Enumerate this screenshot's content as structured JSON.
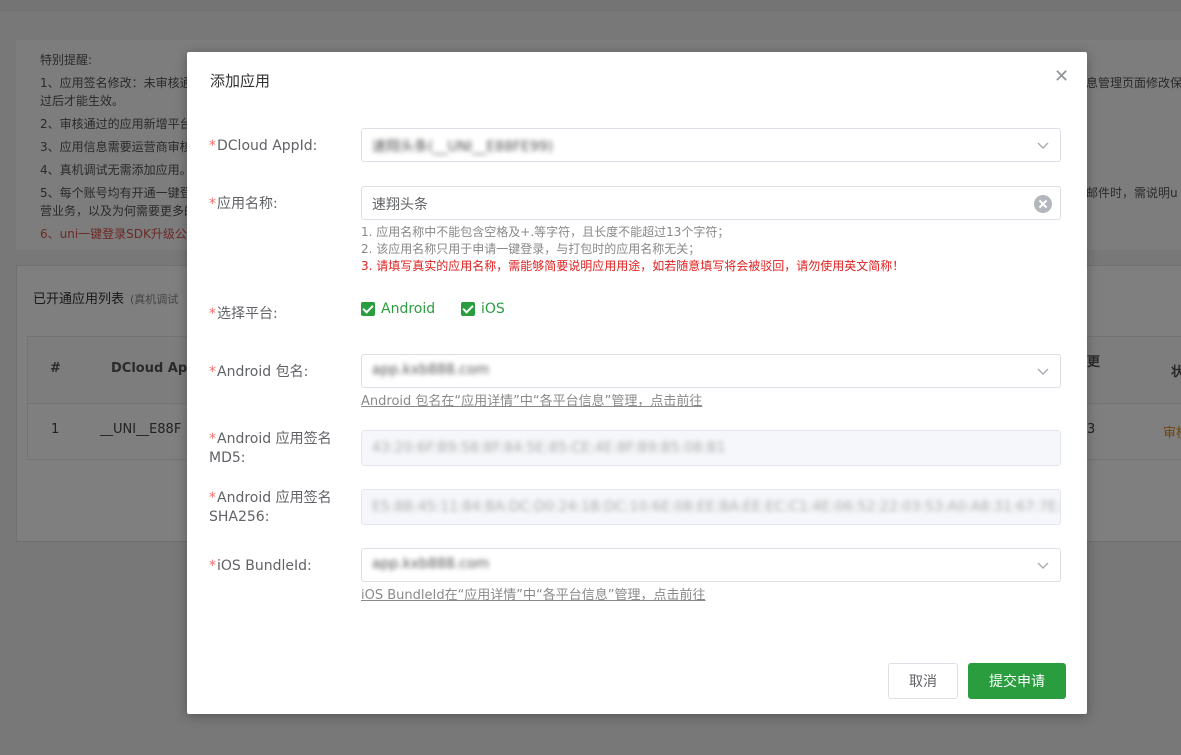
{
  "background": {
    "notice": {
      "title": "特别提醒:",
      "lines": [
        "1、应用签名修改：未审核通",
        "过后才能生效。",
        "2、审核通过的应用新增平台",
        "3、应用信息需要运营商审核",
        "4、真机调试无需添加应用。",
        "5、每个账号均有开通一键登",
        "营业务，以及为何需要更多的",
        "6、uni一键登录SDK升级公告"
      ],
      "right_lines": [
        "息管理页面修改保存",
        "邮件时，需说明u"
      ]
    },
    "list": {
      "title": "已开通应用列表",
      "subtitle": "(真机调试",
      "headers": [
        "#",
        "DCloud App",
        "更",
        "状"
      ],
      "row": {
        "index": "1",
        "appid": "__UNI__E88F",
        "num": "3",
        "status": "审核"
      }
    }
  },
  "modal": {
    "title": "添加应用",
    "close_icon": "close-icon",
    "fields": {
      "appid": {
        "label": "DCloud AppId:",
        "value": "速翔头条(__UNI__E88FE99)"
      },
      "app_name": {
        "label": "应用名称:",
        "value": "速翔头条",
        "hints": [
          "1. 应用名称中不能包含空格及+.等字符，且长度不能超过13个字符；",
          "2. 该应用名称只用于申请一键登录，与打包时的应用名称无关；"
        ],
        "warning": "3. 请填写真实的应用名称，需能够简要说明应用用途，如若随意填写将会被驳回，请勿使用英文简称！"
      },
      "platform": {
        "label": "选择平台:",
        "options": [
          {
            "label": "Android",
            "checked": true
          },
          {
            "label": "iOS",
            "checked": true
          }
        ]
      },
      "android_package": {
        "label": "Android 包名:",
        "value": "app.kxb888.com",
        "link": "Android 包名在“应用详情”中“各平台信息”管理，点击前往"
      },
      "android_md5": {
        "label": "Android 应用签名MD5:",
        "value": "43:20:6F:B9:58:8F:84:5E:85:CE:4E:8F:B9:B5:08:B1"
      },
      "android_sha256": {
        "label": "Android 应用签名SHA256:",
        "value": "E5:8B:45:11:84:BA:DC:D0:24:1B:DC:10:6E:08:EE:BA:EE:EC:C1:4E:06:52:22:03:53:A0:A8:31:67:7E:03:4E"
      },
      "ios_bundle": {
        "label": "iOS BundleId:",
        "value": "app.kxb888.com",
        "link": "iOS BundleId在“应用详情”中“各平台信息”管理，点击前往"
      }
    },
    "buttons": {
      "cancel": "取消",
      "submit": "提交申请"
    },
    "colors": {
      "primary": "#2a9d3e",
      "required": "#f56c6c",
      "warning": "#e02020"
    }
  }
}
